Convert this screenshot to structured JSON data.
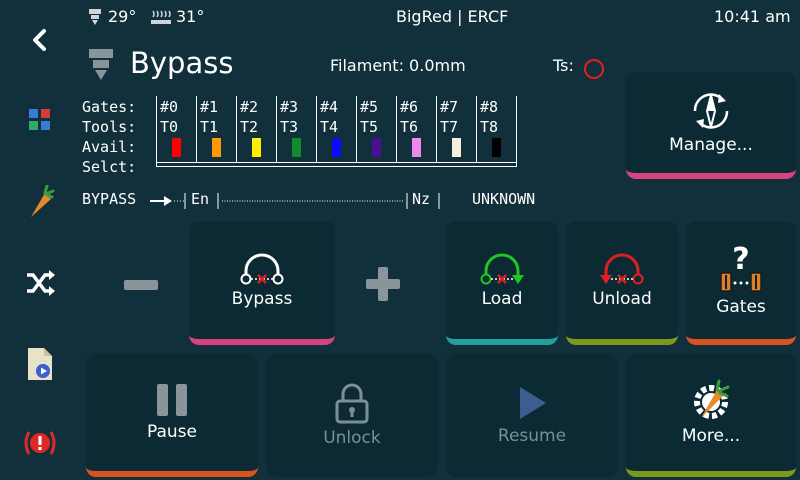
{
  "topbar": {
    "extruder_temp": "29°",
    "bed_temp": "31°",
    "title": "BigRed | ERCF",
    "clock": "10:41 am"
  },
  "header": {
    "title": "Bypass",
    "filament": "Filament: 0.0mm",
    "ts_label": "Ts:"
  },
  "gates_table": {
    "row_labels": [
      "Gates:",
      "Tools:",
      "Avail:",
      "Selct:"
    ],
    "gates": [
      "#0",
      "#1",
      "#2",
      "#3",
      "#4",
      "#5",
      "#6",
      "#7",
      "#8"
    ],
    "tools": [
      "T0",
      "T1",
      "T2",
      "T3",
      "T4",
      "T5",
      "T6",
      "T7",
      "T8"
    ],
    "colors": [
      "#ff0000",
      "#ff9900",
      "#ffee00",
      "#0f8f2a",
      "#0a0aff",
      "#4b1090",
      "#ee88ee",
      "#f4f0dc",
      "#000000"
    ]
  },
  "filament_path": {
    "start": "BYPASS",
    "entry": "En",
    "nozzle": "Nz",
    "status": "UNKNOWN"
  },
  "buttons": {
    "manage": "Manage...",
    "bypass": "Bypass",
    "load": "Load",
    "unload": "Unload",
    "gates": "Gates",
    "pause": "Pause",
    "unlock": "Unlock",
    "resume": "Resume",
    "more": "More..."
  },
  "icons": {
    "back": "back-chevron-icon",
    "menu": "grid-menu-icon",
    "filament": "carrot-icon",
    "shuffle": "shuffle-icon",
    "jobs": "file-play-icon",
    "emergency": "emergency-stop-icon"
  },
  "colors": {
    "background": "#11303b",
    "button": "#0b2a33",
    "accent_pink": "#d6437f",
    "accent_teal": "#23a09c",
    "accent_olive": "#7a9a1e",
    "accent_orange": "#d9531e",
    "sensor_red": "#e02020"
  }
}
